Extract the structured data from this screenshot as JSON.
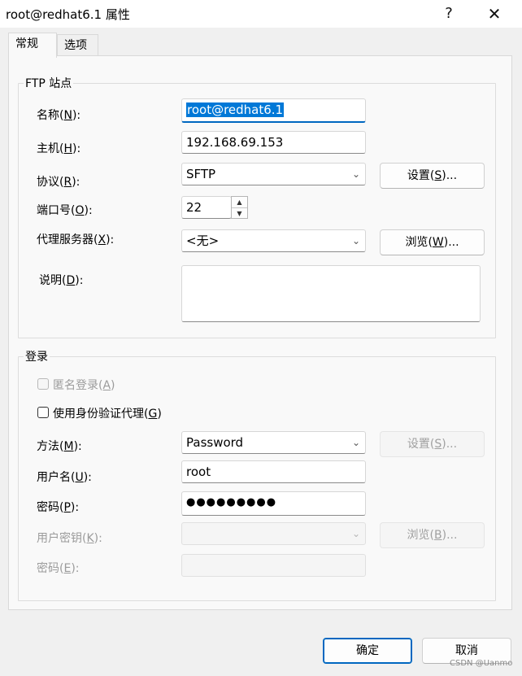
{
  "window": {
    "title": "root@redhat6.1 属性",
    "help_glyph": "?",
    "close_glyph": "✕"
  },
  "tabs": [
    {
      "label": "常规",
      "active": true
    },
    {
      "label": "选项",
      "active": false
    }
  ],
  "ftp_site": {
    "legend": "FTP 站点",
    "name_label": "名称",
    "name_key": "N",
    "name_value": "root@redhat6.1",
    "host_label": "主机",
    "host_key": "H",
    "host_value": "192.168.69.153",
    "protocol_label": "协议",
    "protocol_key": "R",
    "protocol_value": "SFTP",
    "protocol_settings_label": "设置",
    "protocol_settings_key": "S",
    "port_label": "端口号",
    "port_key": "O",
    "port_value": "22",
    "proxy_label": "代理服务器",
    "proxy_key": "X",
    "proxy_value": "<无>",
    "proxy_browse_label": "浏览",
    "proxy_browse_key": "W",
    "desc_label": "说明",
    "desc_key": "D",
    "desc_value": ""
  },
  "login": {
    "legend": "登录",
    "anonymous_label": "匿名登录",
    "anonymous_key": "A",
    "auth_agent_label": "使用身份验证代理",
    "auth_agent_key": "G",
    "method_label": "方法",
    "method_key": "M",
    "method_value": "Password",
    "method_settings_label": "设置",
    "method_settings_key": "S",
    "username_label": "用户名",
    "username_key": "U",
    "username_value": "root",
    "password_label": "密码",
    "password_key": "P",
    "password_value": "●●●●●●●●●",
    "userkey_label": "用户密钥",
    "userkey_key": "K",
    "userkey_browse_label": "浏览",
    "userkey_browse_key": "B",
    "passphrase_label": "密码",
    "passphrase_key": "E"
  },
  "footer": {
    "ok_label": "确定",
    "cancel_label": "取消"
  },
  "watermark": "CSDN @Uanmo",
  "icons": {
    "dropdown": "chevron-down-icon",
    "spin_up": "triangle-up-icon",
    "spin_down": "triangle-down-icon"
  },
  "colors": {
    "accent": "#0067c0",
    "selection": "#0078d7"
  }
}
